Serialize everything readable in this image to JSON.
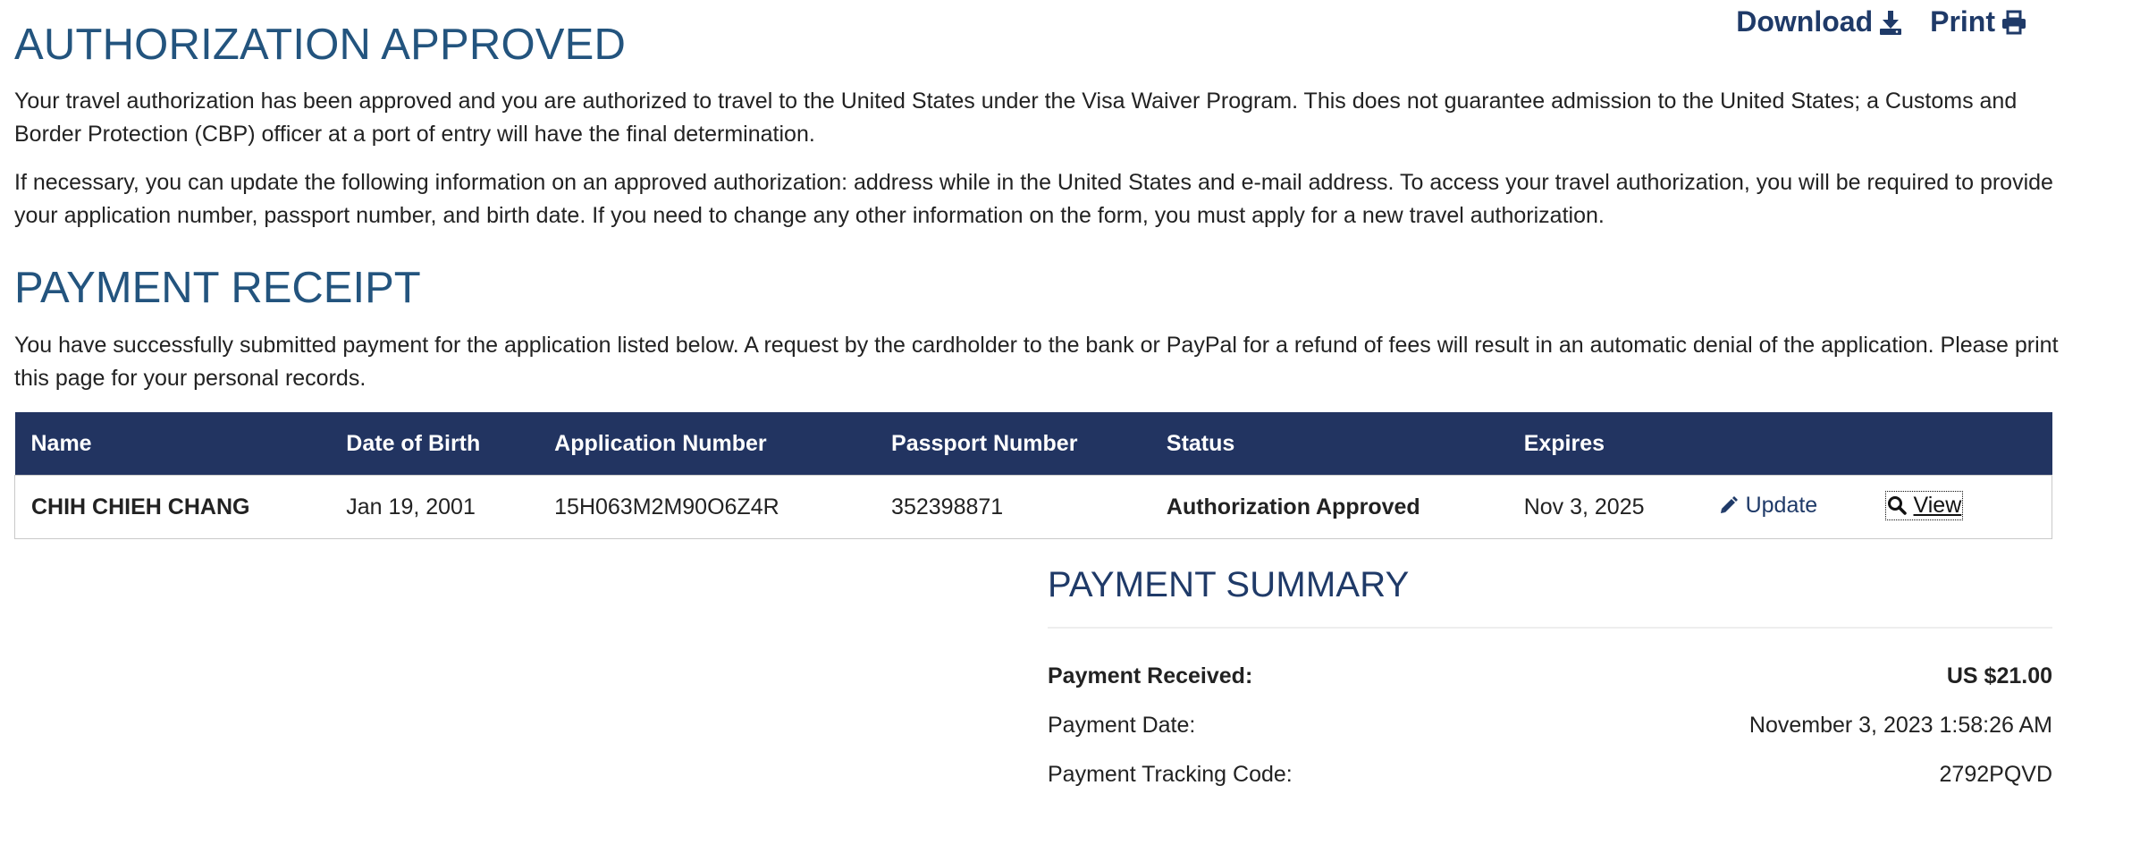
{
  "top_actions": {
    "download_label": "Download",
    "download_icon": "download-icon",
    "print_label": "Print",
    "print_icon": "print-icon"
  },
  "authorization": {
    "title": "AUTHORIZATION APPROVED",
    "paragraph1": "Your travel authorization has been approved and you are authorized to travel to the United States under the Visa Waiver Program. This does not guarantee admission to the United States; a Customs and Border Protection (CBP) officer at a port of entry will have the final determination.",
    "paragraph2": "If necessary, you can update the following information on an approved authorization: address while in the United States and e-mail address. To access your travel authorization, you will be required to provide your application number, passport number, and birth date. If you need to change any other information on the form, you must apply for a new travel authorization."
  },
  "receipt": {
    "title": "PAYMENT RECEIPT",
    "paragraph": "You have successfully submitted payment for the application listed below. A request by the cardholder to the bank or PayPal for a refund of fees will result in an automatic denial of the application. Please print this page for your personal records."
  },
  "table": {
    "headers": {
      "name": "Name",
      "dob": "Date of Birth",
      "app_number": "Application Number",
      "passport": "Passport Number",
      "status": "Status",
      "expires": "Expires"
    },
    "rows": [
      {
        "name": "CHIH CHIEH CHANG",
        "dob": "Jan 19, 2001",
        "app_number": "15H063M2M90O6Z4R",
        "passport": "352398871",
        "status": "Authorization Approved",
        "expires": "Nov 3, 2025",
        "update_label": "Update",
        "view_label": "View"
      }
    ]
  },
  "summary": {
    "title": "PAYMENT SUMMARY",
    "received_label": "Payment Received:",
    "received_value": "US $21.00",
    "date_label": "Payment Date:",
    "date_value": "November 3, 2023 1:58:26 AM",
    "tracking_label": "Payment Tracking Code:",
    "tracking_value": "2792PQVD"
  },
  "colors": {
    "heading": "#23547e",
    "table_header_bg": "#223461",
    "link": "#1f3a68"
  }
}
